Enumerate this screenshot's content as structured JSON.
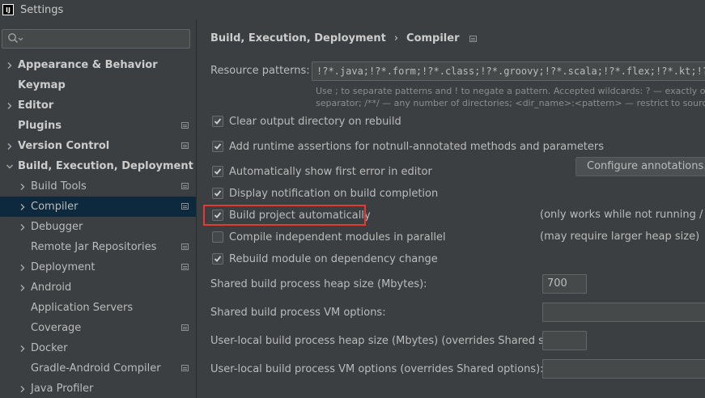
{
  "window": {
    "app_logo": "IJ",
    "title": "Settings"
  },
  "search": {
    "icon": "search-icon",
    "placeholder": ""
  },
  "sidebar": {
    "items": [
      {
        "label": "Appearance & Behavior",
        "bold": true,
        "expandable": true,
        "expanded": false,
        "level": 0,
        "page_icon": false,
        "selected": false
      },
      {
        "label": "Keymap",
        "bold": true,
        "expandable": false,
        "level": 0,
        "page_icon": false,
        "selected": false
      },
      {
        "label": "Editor",
        "bold": true,
        "expandable": true,
        "expanded": false,
        "level": 0,
        "page_icon": false,
        "selected": false
      },
      {
        "label": "Plugins",
        "bold": true,
        "expandable": false,
        "level": 0,
        "page_icon": true,
        "selected": false
      },
      {
        "label": "Version Control",
        "bold": true,
        "expandable": true,
        "expanded": false,
        "level": 0,
        "page_icon": true,
        "selected": false
      },
      {
        "label": "Build, Execution, Deployment",
        "bold": true,
        "expandable": true,
        "expanded": true,
        "level": 0,
        "page_icon": false,
        "selected": false
      },
      {
        "label": "Build Tools",
        "bold": false,
        "expandable": true,
        "expanded": false,
        "level": 1,
        "page_icon": true,
        "selected": false
      },
      {
        "label": "Compiler",
        "bold": false,
        "expandable": true,
        "expanded": false,
        "level": 1,
        "page_icon": true,
        "selected": true
      },
      {
        "label": "Debugger",
        "bold": false,
        "expandable": true,
        "expanded": false,
        "level": 1,
        "page_icon": false,
        "selected": false
      },
      {
        "label": "Remote Jar Repositories",
        "bold": false,
        "expandable": false,
        "level": 1,
        "page_icon": true,
        "selected": false
      },
      {
        "label": "Deployment",
        "bold": false,
        "expandable": true,
        "expanded": false,
        "level": 1,
        "page_icon": true,
        "selected": false
      },
      {
        "label": "Android",
        "bold": false,
        "expandable": true,
        "expanded": false,
        "level": 1,
        "page_icon": false,
        "selected": false
      },
      {
        "label": "Application Servers",
        "bold": false,
        "expandable": false,
        "level": 1,
        "page_icon": false,
        "selected": false
      },
      {
        "label": "Coverage",
        "bold": false,
        "expandable": false,
        "level": 1,
        "page_icon": true,
        "selected": false
      },
      {
        "label": "Docker",
        "bold": false,
        "expandable": true,
        "expanded": false,
        "level": 1,
        "page_icon": false,
        "selected": false
      },
      {
        "label": "Gradle-Android Compiler",
        "bold": false,
        "expandable": false,
        "level": 1,
        "page_icon": true,
        "selected": false
      },
      {
        "label": "Java Profiler",
        "bold": false,
        "expandable": true,
        "expanded": false,
        "level": 1,
        "page_icon": false,
        "selected": false
      }
    ]
  },
  "breadcrumb": {
    "parent": "Build, Execution, Deployment",
    "separator": "›",
    "current": "Compiler"
  },
  "resource_patterns": {
    "label": "Resource patterns:",
    "value": "!?*.java;!?*.form;!?*.class;!?*.groovy;!?*.scala;!?*.flex;!?*.kt;!?*.clj;!?*.aj",
    "hint_line1": "Use ; to separate patterns and ! to negate a pattern. Accepted wildcards: ? — exactly one symbol; * — zero or more symbols; / — path",
    "hint_line2": "separator; /**/ — any number of directories; <dir_name>:<pattern> — restrict to source roots with the specified name"
  },
  "checkboxes": [
    {
      "label": "Clear output directory on rebuild",
      "checked": true,
      "note": ""
    },
    {
      "label": "Add runtime assertions for notnull-annotated methods and parameters",
      "checked": true,
      "note": ""
    },
    {
      "label": "Automatically show first error in editor",
      "checked": true,
      "note": ""
    },
    {
      "label": "Display notification on build completion",
      "checked": true,
      "note": ""
    },
    {
      "label": "Build project automatically",
      "checked": true,
      "note": "(only works while not running / debugging)"
    },
    {
      "label": "Compile independent modules in parallel",
      "checked": false,
      "note": "(may require larger heap size)"
    },
    {
      "label": "Rebuild module on dependency change",
      "checked": true,
      "note": ""
    }
  ],
  "configure_button": {
    "label": "Configure annotations..."
  },
  "fields": [
    {
      "label": "Shared build process heap size (Mbytes):",
      "value": "700"
    },
    {
      "label": "Shared build process VM options:",
      "value": ""
    },
    {
      "label": "User-local build process heap size (Mbytes) (overrides Shared size):",
      "value": ""
    },
    {
      "label": "User-local build process VM options (overrides Shared options):",
      "value": ""
    }
  ],
  "colors": {
    "background": "#3c3f41",
    "selection": "#0d293e",
    "highlight_box": "#e53935",
    "text": "#bbbbbb"
  }
}
